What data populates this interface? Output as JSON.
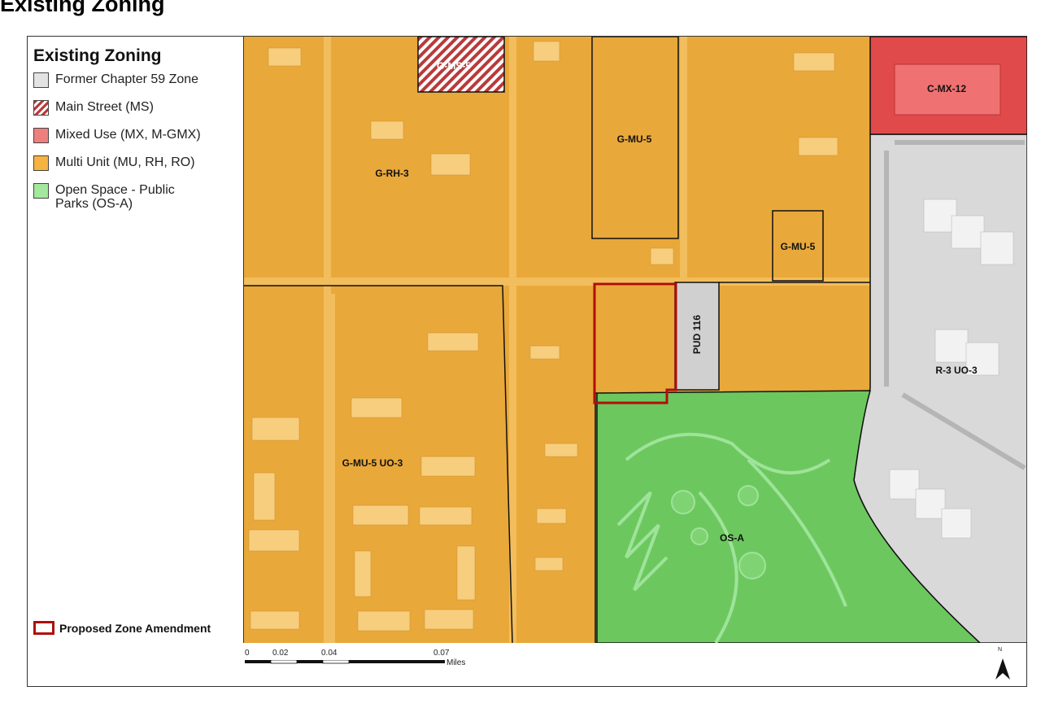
{
  "heading": "Existing Zoning",
  "legend": {
    "title": "Existing Zoning",
    "items": [
      {
        "label": "Former Chapter 59 Zone",
        "color": "#e3e3e3",
        "pattern": "solid"
      },
      {
        "label": "Main Street  (MS)",
        "color": "#b93a3a",
        "pattern": "hatch"
      },
      {
        "label": "Mixed Use  (MX, M-GMX)",
        "color": "#ef7f7f",
        "pattern": "solid"
      },
      {
        "label": "Multi Unit  (MU, RH, RO)",
        "color": "#f5b340",
        "pattern": "solid"
      },
      {
        "label": "Open Space - Public Parks  (OS-A)",
        "color": "#a3e89c",
        "pattern": "solid"
      }
    ],
    "amendment_label": "Proposed Zone Amendment",
    "amendment_color": "#b00d0d"
  },
  "zones": [
    {
      "label": "G-MS-5",
      "category": "Main Street"
    },
    {
      "label": "C-MX-12",
      "category": "Mixed Use"
    },
    {
      "label": "G-MU-5",
      "category": "Multi Unit"
    },
    {
      "label": "G-RH-3",
      "category": "Multi Unit"
    },
    {
      "label": "G-MU-5",
      "category": "Multi Unit"
    },
    {
      "label": "PUD 116",
      "category": "Former Chapter 59 Zone"
    },
    {
      "label": "R-3 UO-3",
      "category": "Former Chapter 59 Zone"
    },
    {
      "label": "G-MU-5 UO-3",
      "category": "Multi Unit"
    },
    {
      "label": "OS-A",
      "category": "Open Space"
    }
  ],
  "scale": {
    "ticks": [
      "0",
      "0.02",
      "0.04",
      "0.07"
    ],
    "unit": "Miles"
  },
  "north_label": "N"
}
